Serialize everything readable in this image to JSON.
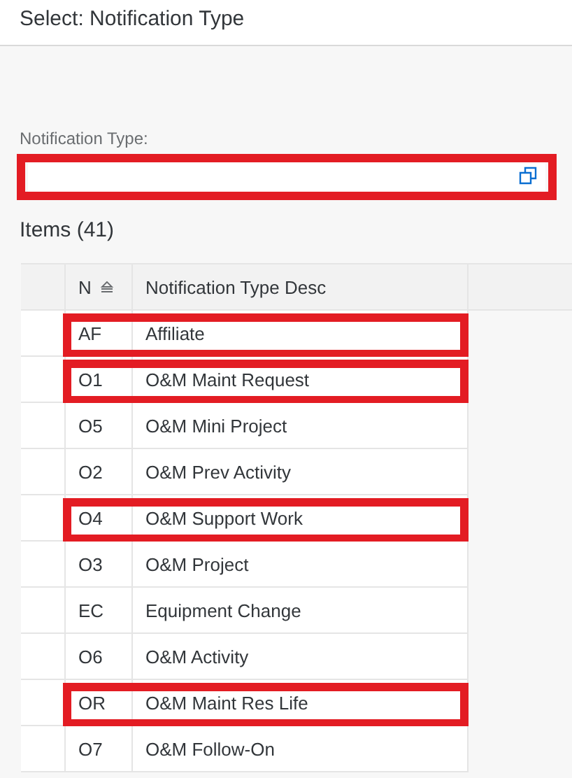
{
  "dialog": {
    "title": "Select: Notification Type"
  },
  "field": {
    "label": "Notification Type:",
    "highlighted": true
  },
  "items_heading": "Items (41)",
  "table": {
    "columns": [
      {
        "label": "N",
        "sorted": true
      },
      {
        "label": "Notification Type Desc",
        "sorted": false
      }
    ],
    "rows": [
      {
        "code": "AF",
        "desc": "Affiliate",
        "highlighted": true
      },
      {
        "code": "O1",
        "desc": "O&M Maint Request",
        "highlighted": true
      },
      {
        "code": "O5",
        "desc": "O&M Mini Project",
        "highlighted": false
      },
      {
        "code": "O2",
        "desc": "O&M Prev Activity",
        "highlighted": false
      },
      {
        "code": "O4",
        "desc": "O&M Support Work",
        "highlighted": true
      },
      {
        "code": "O3",
        "desc": "O&M Project",
        "highlighted": false
      },
      {
        "code": "EC",
        "desc": "Equipment Change",
        "highlighted": false
      },
      {
        "code": "O6",
        "desc": "O&M Activity",
        "highlighted": false
      },
      {
        "code": "OR",
        "desc": "O&M Maint Res Life",
        "highlighted": true
      },
      {
        "code": "O7",
        "desc": "O&M Follow-On",
        "highlighted": false
      }
    ]
  }
}
